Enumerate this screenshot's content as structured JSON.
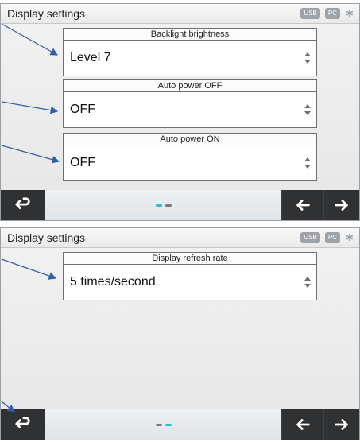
{
  "screens": [
    {
      "title": "Display settings",
      "status": {
        "usb_label": "USB",
        "pc_label": "PC",
        "bluetooth_symbol": "✱"
      },
      "settings": [
        {
          "label": "Backlight brightness",
          "value": "Level 7"
        },
        {
          "label": "Auto power OFF",
          "value": "OFF"
        },
        {
          "label": "Auto power ON",
          "value": "OFF"
        }
      ],
      "pager": {
        "pages": 2,
        "active": 1
      }
    },
    {
      "title": "Display settings",
      "status": {
        "usb_label": "USB",
        "pc_label": "PC",
        "bluetooth_symbol": "✱"
      },
      "settings": [
        {
          "label": "Display refresh rate",
          "value": "5 times/second"
        }
      ],
      "pager": {
        "pages": 2,
        "active": 2
      }
    }
  ],
  "icons": {
    "back": "return-icon",
    "prev": "arrow-left-icon",
    "next": "arrow-right-icon",
    "select": "updown-icon"
  },
  "colors": {
    "bar": "#2f3133",
    "pager_active": "#2dbbd6",
    "annotation": "#2f5fa8"
  }
}
